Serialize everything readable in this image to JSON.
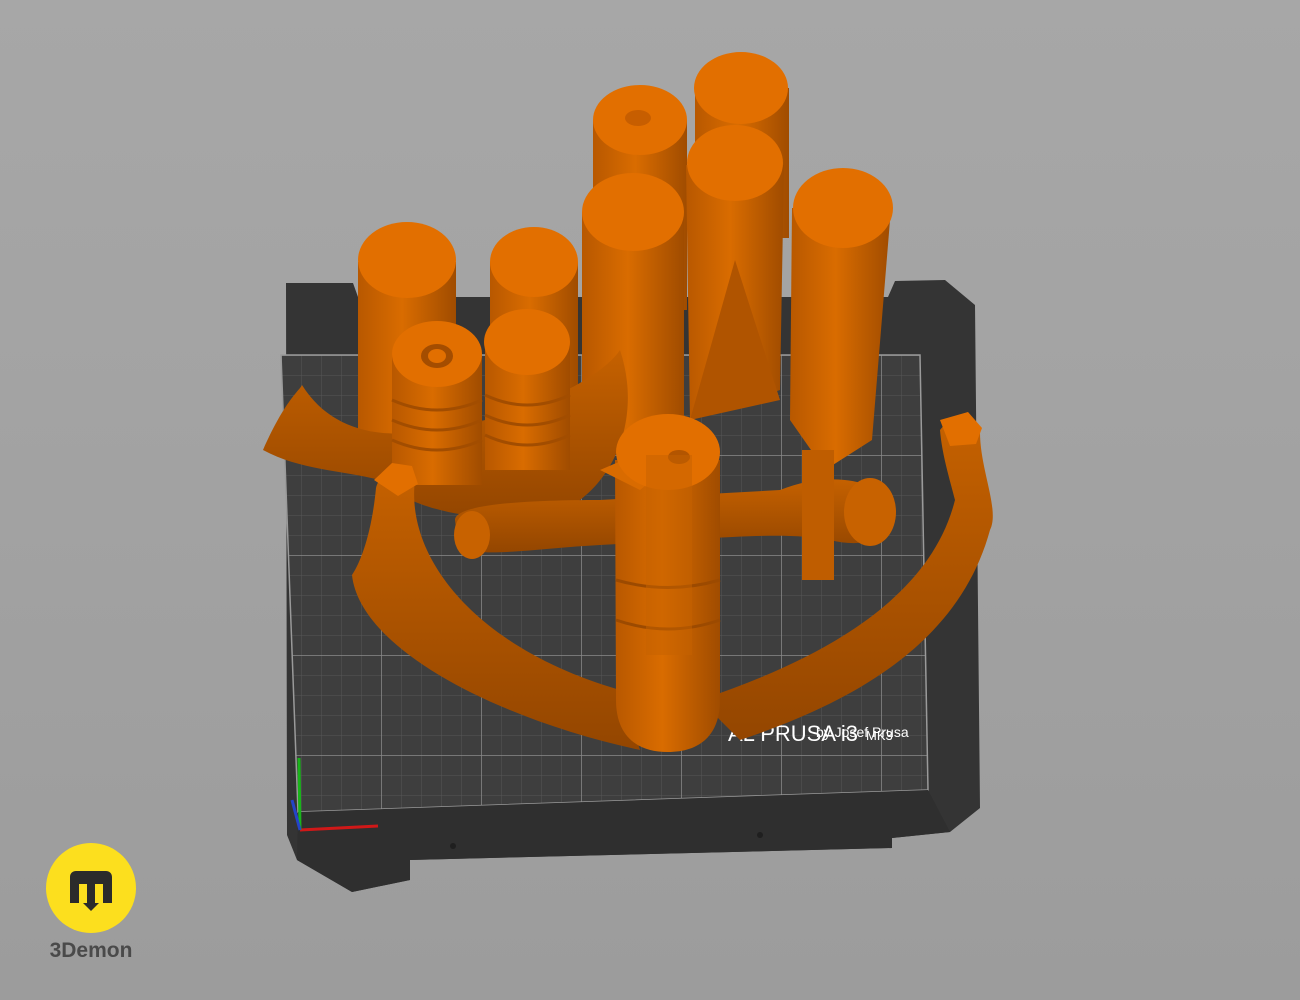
{
  "scene": {
    "bed_brand": "AL PRUSA i3",
    "bed_model": "MK3",
    "bed_maker": "by Josef Prusa",
    "model_color": "#de6d00",
    "bed_color": "#3b3b3b",
    "background_color": "#a5a5a5"
  },
  "axes": {
    "x_color": "#d01818",
    "y_color": "#19b41a",
    "z_color": "#2444c8"
  },
  "watermark": {
    "brand_name": "3Demon",
    "badge_color": "#fcdf1e",
    "icon": "3demon-logo-icon"
  }
}
